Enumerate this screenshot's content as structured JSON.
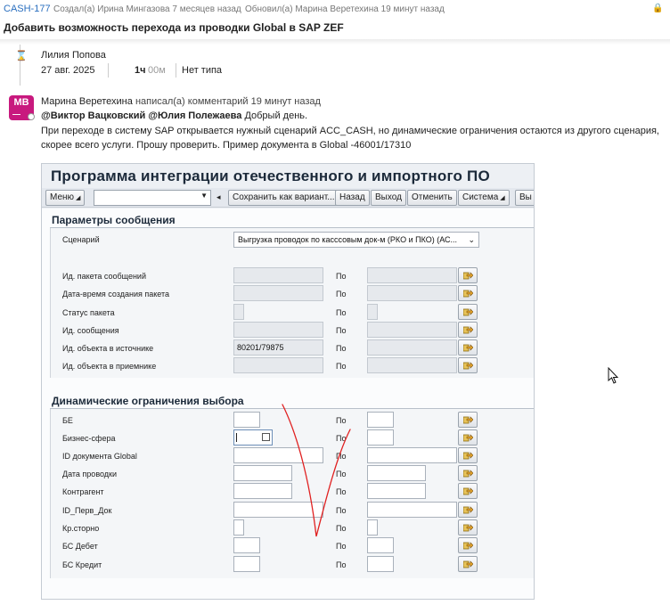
{
  "header": {
    "issue_key": "CASH-177",
    "created": "Создал(а) Ирина Мингазова 7 месяцев назад",
    "updated": "Обновил(а) Марина Веретехина 19 минут назад",
    "lock": "🔒",
    "title": "Добавить возможность перехода из проводки Global в SAP ZEF"
  },
  "worklog": {
    "author": "Лилия Попова",
    "date": "27 авг. 2025",
    "hours": "1ч",
    "minutes": "00м",
    "type": "Нет типа"
  },
  "comment": {
    "avatar_initials": "МВ",
    "avatar_dash": "—",
    "author": "Марина Веретехина",
    "action": "написал(а) комментарий 19 минут назад",
    "mention1": "@Виктор Вацковский",
    "mention2": "@Юлия Полежаева",
    "greeting": "Добрый день.",
    "line2": "При переходе в систему SAP открывается нужный сценарий ACC_CASH, но динамические ограничения остаются из другого сценария,",
    "line3": "скорее всего услуги. Прошу проверить. Пример документа в Global -46001/17310"
  },
  "sap": {
    "title": "Программа интеграции отечественного и импортного ПО",
    "toolbar": {
      "menu": "Меню",
      "save_variant": "Сохранить как вариант...",
      "back": "Назад",
      "exit": "Выход",
      "cancel": "Отменить",
      "system": "Система",
      "cut": "Вы"
    },
    "section1": "Параметры сообщения",
    "scenario_label": "Сценарий",
    "scenario_value": "Выгрузка проводок по касссовым док-м (РКО и ПКО) (АС...",
    "po": "По",
    "params": [
      {
        "label": "Ид. пакета сообщений",
        "value": ""
      },
      {
        "label": "Дата-время создания пакета",
        "value": ""
      },
      {
        "label": "Статус пакета",
        "value": ""
      },
      {
        "label": "Ид. сообщения",
        "value": ""
      },
      {
        "label": "Ид. объекта в источнике",
        "value": "80201/79875"
      },
      {
        "label": "Ид. объекта в приемнике",
        "value": ""
      }
    ],
    "section2": "Динамические ограничения выбора",
    "dyn": [
      {
        "label": "БЕ"
      },
      {
        "label": "Бизнес-сфера"
      },
      {
        "label": "ID документа Global"
      },
      {
        "label": "Дата проводки"
      },
      {
        "label": "Контрагент"
      },
      {
        "label": "ID_Перв_Док"
      },
      {
        "label": "Кр.сторно"
      },
      {
        "label": "БС Дебет"
      },
      {
        "label": "БС Кредит"
      }
    ]
  }
}
